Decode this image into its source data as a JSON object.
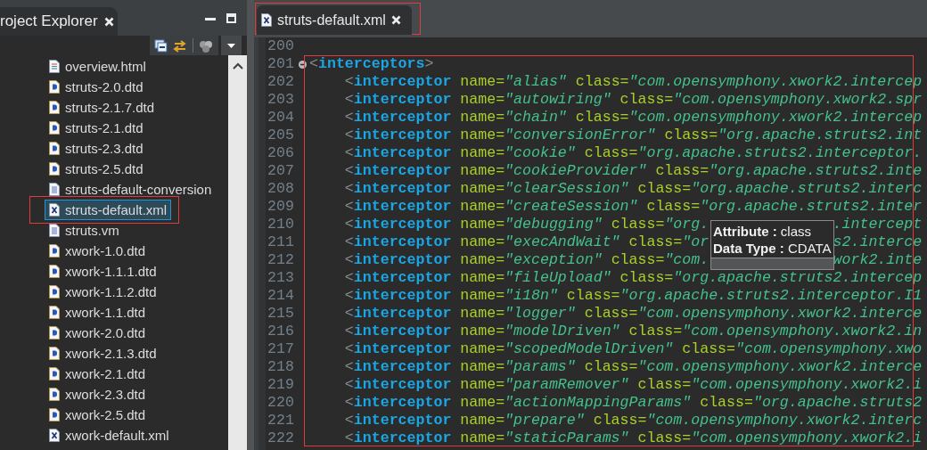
{
  "explorer": {
    "title": "roject Explorer"
  },
  "tree": {
    "items": [
      {
        "label": "overview.html",
        "kind": "html",
        "selected": false,
        "highlighted": false
      },
      {
        "label": "struts-2.0.dtd",
        "kind": "dtd",
        "selected": false,
        "highlighted": false
      },
      {
        "label": "struts-2.1.7.dtd",
        "kind": "dtd",
        "selected": false,
        "highlighted": false
      },
      {
        "label": "struts-2.1.dtd",
        "kind": "dtd",
        "selected": false,
        "highlighted": false
      },
      {
        "label": "struts-2.3.dtd",
        "kind": "dtd",
        "selected": false,
        "highlighted": false
      },
      {
        "label": "struts-2.5.dtd",
        "kind": "dtd",
        "selected": false,
        "highlighted": false
      },
      {
        "label": "struts-default-conversion",
        "kind": "text",
        "selected": false,
        "highlighted": false
      },
      {
        "label": "struts-default.xml",
        "kind": "xml",
        "selected": true,
        "highlighted": true
      },
      {
        "label": "struts.vm",
        "kind": "text",
        "selected": false,
        "highlighted": false
      },
      {
        "label": "xwork-1.0.dtd",
        "kind": "dtd",
        "selected": false,
        "highlighted": false
      },
      {
        "label": "xwork-1.1.1.dtd",
        "kind": "dtd",
        "selected": false,
        "highlighted": false
      },
      {
        "label": "xwork-1.1.2.dtd",
        "kind": "dtd",
        "selected": false,
        "highlighted": false
      },
      {
        "label": "xwork-1.1.dtd",
        "kind": "dtd",
        "selected": false,
        "highlighted": false
      },
      {
        "label": "xwork-2.0.dtd",
        "kind": "dtd",
        "selected": false,
        "highlighted": false
      },
      {
        "label": "xwork-2.1.3.dtd",
        "kind": "dtd",
        "selected": false,
        "highlighted": false
      },
      {
        "label": "xwork-2.1.dtd",
        "kind": "dtd",
        "selected": false,
        "highlighted": false
      },
      {
        "label": "xwork-2.3.dtd",
        "kind": "dtd",
        "selected": false,
        "highlighted": false
      },
      {
        "label": "xwork-2.5.dtd",
        "kind": "dtd",
        "selected": false,
        "highlighted": false
      },
      {
        "label": "xwork-default.xml",
        "kind": "xml",
        "selected": false,
        "highlighted": false
      }
    ]
  },
  "editor": {
    "tabs": [
      {
        "label": "struts-default.xml",
        "selected": true,
        "highlighted": true
      }
    ],
    "code": {
      "highlighted": true,
      "lines": [
        {
          "number": "200"
        },
        {
          "number": "201",
          "expanded": true,
          "open": "<",
          "tag": "interceptors",
          "close": ">"
        },
        {
          "number": "202",
          "indented": true,
          "open": "<",
          "tag": "interceptor",
          "attributes": [
            {
              "name": "name=",
              "value": "\"alias\""
            },
            {
              "name": "class=",
              "value": "\"com.opensymphony.xwork2.intercep"
            }
          ]
        },
        {
          "number": "203",
          "indented": true,
          "open": "<",
          "tag": "interceptor",
          "attributes": [
            {
              "name": "name=",
              "value": "\"autowiring\""
            },
            {
              "name": "class=",
              "value": "\"com.opensymphony.xwork2.spr"
            }
          ]
        },
        {
          "number": "204",
          "indented": true,
          "open": "<",
          "tag": "interceptor",
          "attributes": [
            {
              "name": "name=",
              "value": "\"chain\""
            },
            {
              "name": "class=",
              "value": "\"com.opensymphony.xwork2.intercep"
            }
          ]
        },
        {
          "number": "205",
          "indented": true,
          "open": "<",
          "tag": "interceptor",
          "attributes": [
            {
              "name": "name=",
              "value": "\"conversionError\""
            },
            {
              "name": "class=",
              "value": "\"org.apache.struts2.int"
            }
          ]
        },
        {
          "number": "206",
          "indented": true,
          "open": "<",
          "tag": "interceptor",
          "attributes": [
            {
              "name": "name=",
              "value": "\"cookie\""
            },
            {
              "name": "class=",
              "value": "\"org.apache.struts2.interceptor."
            }
          ]
        },
        {
          "number": "207",
          "indented": true,
          "open": "<",
          "tag": "interceptor",
          "attributes": [
            {
              "name": "name=",
              "value": "\"cookieProvider\""
            },
            {
              "name": "class=",
              "value": "\"org.apache.struts2.inte"
            }
          ]
        },
        {
          "number": "208",
          "indented": true,
          "open": "<",
          "tag": "interceptor",
          "attributes": [
            {
              "name": "name=",
              "value": "\"clearSession\""
            },
            {
              "name": "class=",
              "value": "\"org.apache.struts2.interc"
            }
          ]
        },
        {
          "number": "209",
          "indented": true,
          "open": "<",
          "tag": "interceptor",
          "attributes": [
            {
              "name": "name=",
              "value": "\"createSession\""
            },
            {
              "name": "class=",
              "value": "\"org.apache.struts2.inter"
            }
          ]
        },
        {
          "number": "210",
          "indented": true,
          "open": "<",
          "tag": "interceptor",
          "attributes": [
            {
              "name": "name=",
              "value": "\"debugging\""
            },
            {
              "name": "class=",
              "value": "\"org."
            }
          ],
          "after_tooltip": ".intercept"
        },
        {
          "number": "211",
          "indented": true,
          "open": "<",
          "tag": "interceptor",
          "attributes": [
            {
              "name": "name=",
              "value": "\"execAndWait\""
            },
            {
              "name": "class=",
              "value": "\"or"
            }
          ],
          "after_tooltip": "s2.interce"
        },
        {
          "number": "212",
          "indented": true,
          "open": "<",
          "tag": "interceptor",
          "attributes": [
            {
              "name": "name=",
              "value": "\"exception\""
            },
            {
              "name": "class=",
              "value": "\"com."
            }
          ],
          "after_tooltip": "work2.inte"
        },
        {
          "number": "213",
          "indented": true,
          "open": "<",
          "tag": "interceptor",
          "attributes": [
            {
              "name": "name=",
              "value": "\"fileUpload\""
            },
            {
              "name": "class=",
              "value": "\"org.apache.struts2.intercep"
            }
          ]
        },
        {
          "number": "214",
          "indented": true,
          "open": "<",
          "tag": "interceptor",
          "attributes": [
            {
              "name": "name=",
              "value": "\"i18n\""
            },
            {
              "name": "class=",
              "value": "\"org.apache.struts2.interceptor.I1"
            }
          ]
        },
        {
          "number": "215",
          "indented": true,
          "open": "<",
          "tag": "interceptor",
          "attributes": [
            {
              "name": "name=",
              "value": "\"logger\""
            },
            {
              "name": "class=",
              "value": "\"com.opensymphony.xwork2.interce"
            }
          ]
        },
        {
          "number": "216",
          "indented": true,
          "open": "<",
          "tag": "interceptor",
          "attributes": [
            {
              "name": "name=",
              "value": "\"modelDriven\""
            },
            {
              "name": "class=",
              "value": "\"com.opensymphony.xwork2.in"
            }
          ]
        },
        {
          "number": "217",
          "indented": true,
          "open": "<",
          "tag": "interceptor",
          "attributes": [
            {
              "name": "name=",
              "value": "\"scopedModelDriven\""
            },
            {
              "name": "class=",
              "value": "\"com.opensymphony.xwo"
            }
          ]
        },
        {
          "number": "218",
          "indented": true,
          "open": "<",
          "tag": "interceptor",
          "attributes": [
            {
              "name": "name=",
              "value": "\"params\""
            },
            {
              "name": "class=",
              "value": "\"com.opensymphony.xwork2.interce"
            }
          ]
        },
        {
          "number": "219",
          "indented": true,
          "open": "<",
          "tag": "interceptor",
          "attributes": [
            {
              "name": "name=",
              "value": "\"paramRemover\""
            },
            {
              "name": "class=",
              "value": "\"com.opensymphony.xwork2.i"
            }
          ]
        },
        {
          "number": "220",
          "indented": true,
          "open": "<",
          "tag": "interceptor",
          "attributes": [
            {
              "name": "name=",
              "value": "\"actionMappingParams\""
            },
            {
              "name": "class=",
              "value": "\"org.apache.struts2"
            }
          ]
        },
        {
          "number": "221",
          "indented": true,
          "open": "<",
          "tag": "interceptor",
          "attributes": [
            {
              "name": "name=",
              "value": "\"prepare\""
            },
            {
              "name": "class=",
              "value": "\"com.opensymphony.xwork2.interc"
            }
          ]
        },
        {
          "number": "222",
          "indented": true,
          "open": "<",
          "tag": "interceptor",
          "attributes": [
            {
              "name": "name=",
              "value": "\"staticParams\""
            },
            {
              "name": "class=",
              "value": "\"com.opensymphony.xwork2.i"
            }
          ]
        }
      ]
    },
    "tooltip": {
      "lines": [
        "**Attribute :** class",
        "**Data Type :** CDATA"
      ]
    }
  }
}
